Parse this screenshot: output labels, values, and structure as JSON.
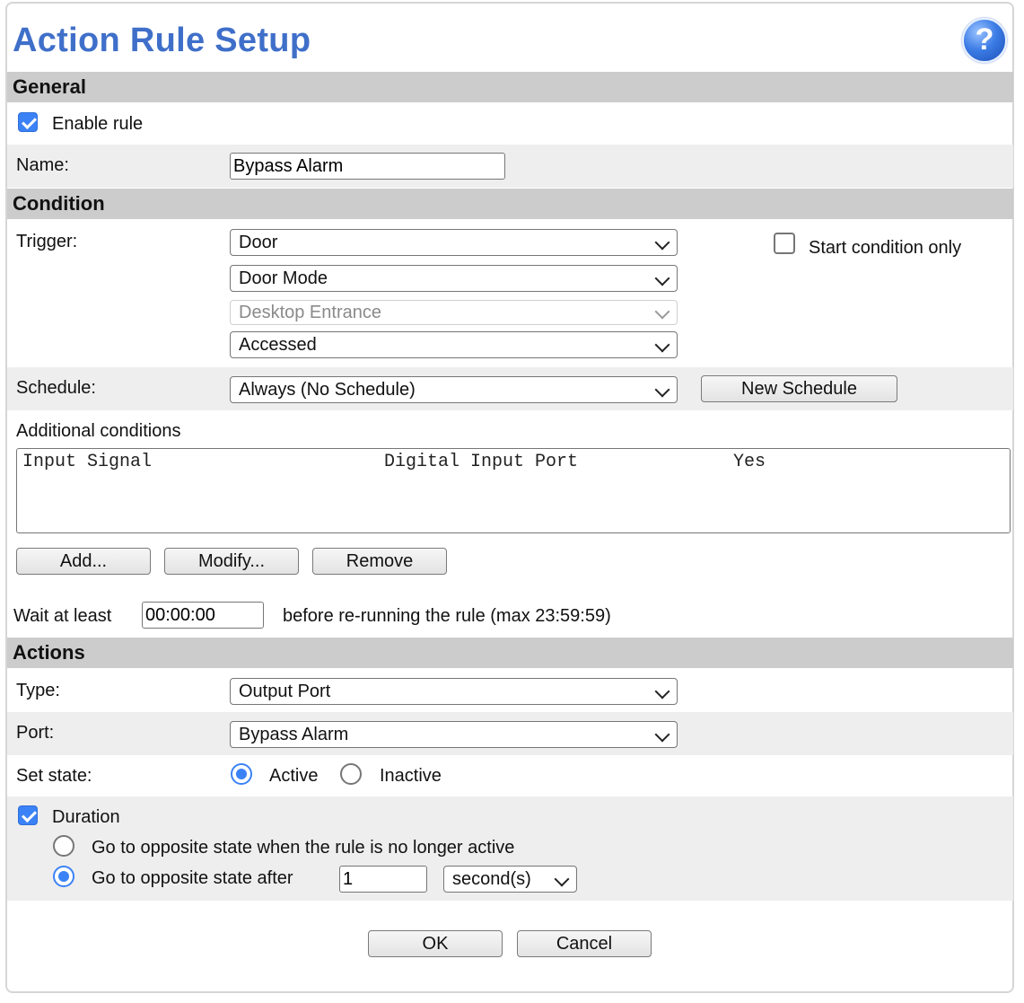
{
  "title": "Action Rule Setup",
  "help_icon": "?",
  "general": {
    "heading": "General",
    "enable_rule": {
      "label": "Enable rule",
      "checked": true
    },
    "name_label": "Name:",
    "name_value": "Bypass Alarm"
  },
  "condition": {
    "heading": "Condition",
    "trigger_label": "Trigger:",
    "trigger_selects": [
      "Door",
      "Door Mode",
      "Desktop Entrance",
      "Accessed"
    ],
    "start_condition_only": {
      "label": "Start condition only",
      "checked": false
    },
    "schedule_label": "Schedule:",
    "schedule_value": "Always (No Schedule)",
    "new_schedule_button": "New Schedule",
    "additional_conditions_label": "Additional conditions",
    "additional_conditions_rows": [
      {
        "col1": "Input Signal",
        "col2": "Digital Input Port",
        "col3": "Yes"
      }
    ],
    "add_button": "Add...",
    "modify_button": "Modify...",
    "remove_button": "Remove",
    "wait_label": "Wait at least",
    "wait_value": "00:00:00",
    "wait_suffix": "before re-running the rule (max 23:59:59)"
  },
  "actions": {
    "heading": "Actions",
    "type_label": "Type:",
    "type_value": "Output Port",
    "port_label": "Port:",
    "port_value": "Bypass Alarm",
    "set_state_label": "Set state:",
    "state_active_label": "Active",
    "state_inactive_label": "Inactive",
    "state_selected": "Active",
    "duration": {
      "label": "Duration",
      "checked": true
    },
    "opt_no_longer_active": "Go to opposite state when the rule is no longer active",
    "opt_after": "Go to opposite state after",
    "opt_selected": "after",
    "after_value": "1",
    "after_unit": "second(s)"
  },
  "footer": {
    "ok_button": "OK",
    "cancel_button": "Cancel"
  }
}
